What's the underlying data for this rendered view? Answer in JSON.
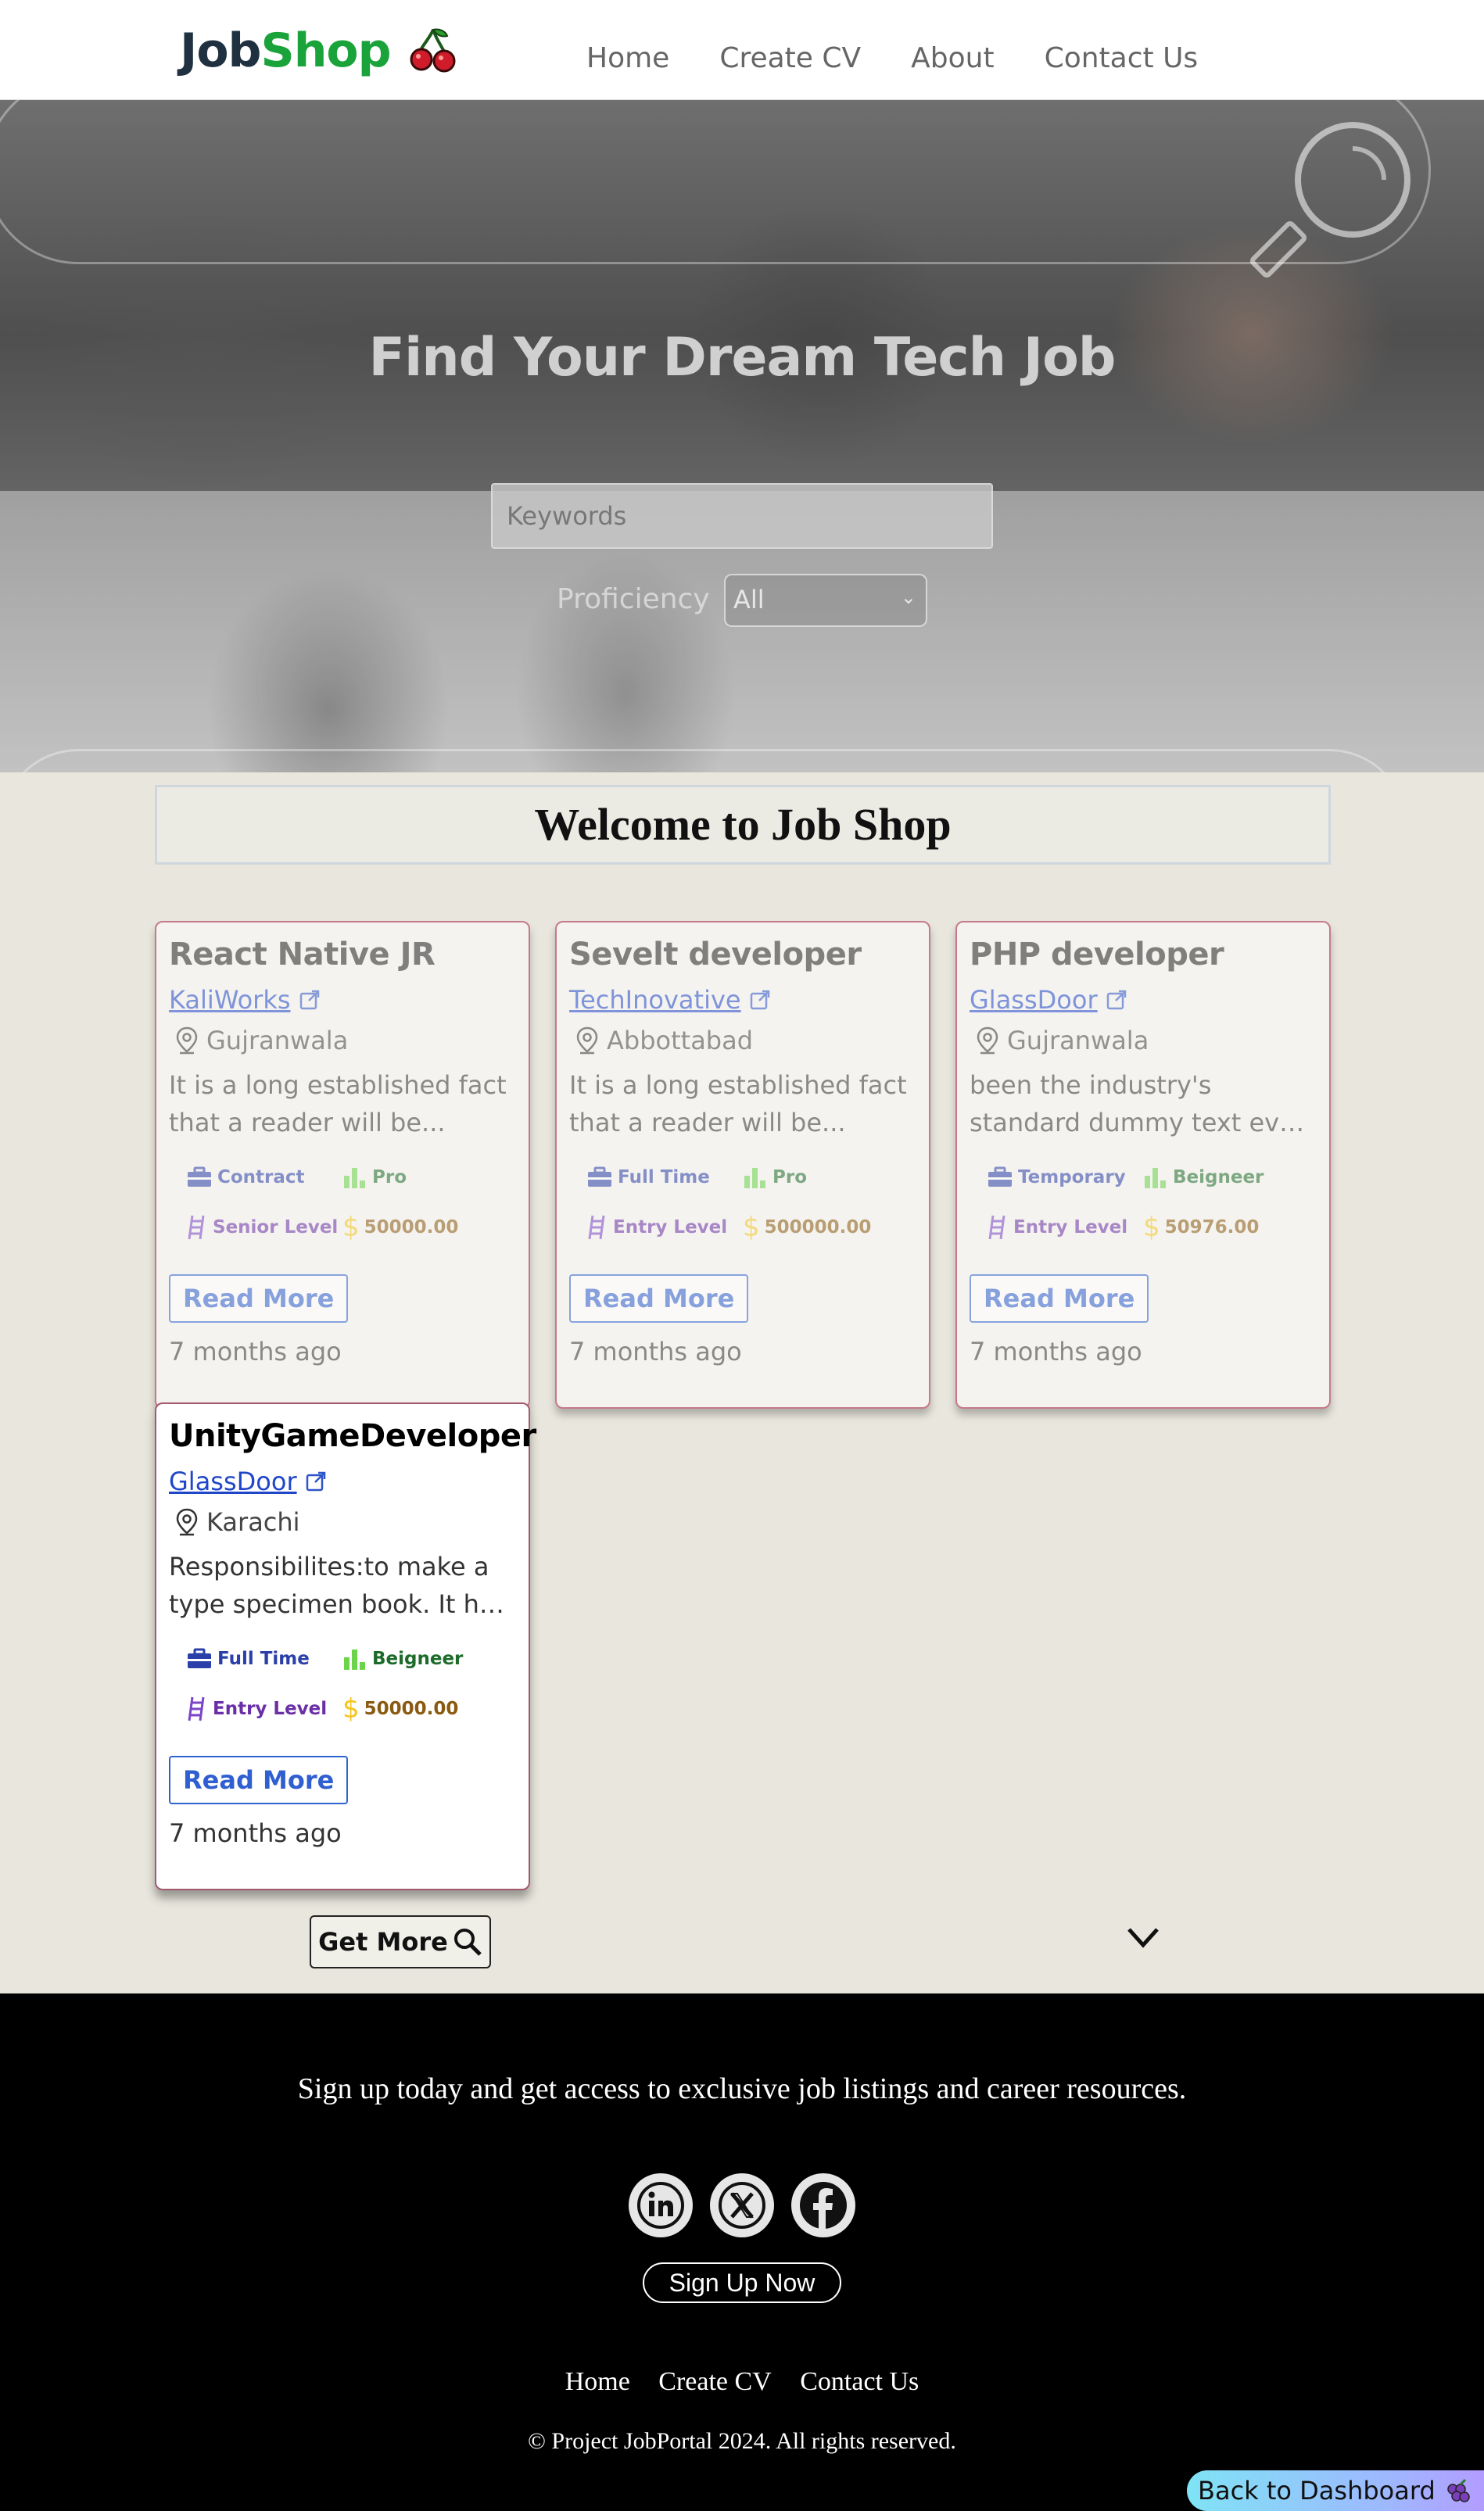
{
  "brand": {
    "part1": "Job",
    "part2": "Shop",
    "logo_icon": "cherry-icon"
  },
  "nav": {
    "items": [
      "Home",
      "Create CV",
      "About",
      "Contact Us"
    ]
  },
  "hero": {
    "title": "Find Your Dream Tech Job",
    "keywords_placeholder": "Keywords",
    "proficiency_label": "Proficiency",
    "proficiency_value": "All"
  },
  "welcome": "Welcome to Job Shop",
  "jobs": [
    {
      "title": "React Native JR",
      "company": "KaliWorks",
      "location": "Gujranwala",
      "desc1": "It is a long established fact",
      "desc2": "that a reader will be...",
      "type": "Contract",
      "proficiency": "Pro",
      "level": "Senior Level",
      "salary": "50000.00",
      "read_more": "Read More",
      "posted": "7 months ago"
    },
    {
      "title": "Sevelt developer",
      "company": "TechInovative",
      "location": "Abbottabad",
      "desc1": "It is a long established fact",
      "desc2": "that a reader will be...",
      "type": "Full Time",
      "proficiency": "Pro",
      "level": "Entry Level",
      "salary": "500000.00",
      "read_more": "Read More",
      "posted": "7 months ago"
    },
    {
      "title": "PHP developer",
      "company": "GlassDoor",
      "location": "Gujranwala",
      "desc1": "been the industry's",
      "desc2": "standard dummy text eve...",
      "type": "Temporary",
      "proficiency": "Beigneer",
      "level": "Entry Level",
      "salary": "50976.00",
      "read_more": "Read More",
      "posted": "7 months ago"
    },
    {
      "title": "UnityGameDeveloper",
      "company": "GlassDoor",
      "location": "Karachi",
      "desc1": "Responsibilites:to make a",
      "desc2": "type specimen book. It ha...",
      "type": "Full Time",
      "proficiency": "Beigneer",
      "level": "Entry Level",
      "salary": "50000.00",
      "read_more": "Read More",
      "posted": "7 months ago"
    }
  ],
  "get_more": "Get More",
  "footer": {
    "tagline": "Sign up today and get access to exclusive job listings and career resources.",
    "socials": [
      "linkedin-icon",
      "x-icon",
      "facebook-icon"
    ],
    "signup": "Sign Up Now",
    "links": [
      "Home",
      "Create CV",
      "Contact Us"
    ],
    "copyright": "© Project JobPortal 2024. All rights reserved."
  },
  "back_to_dashboard": "Back to Dashboard"
}
